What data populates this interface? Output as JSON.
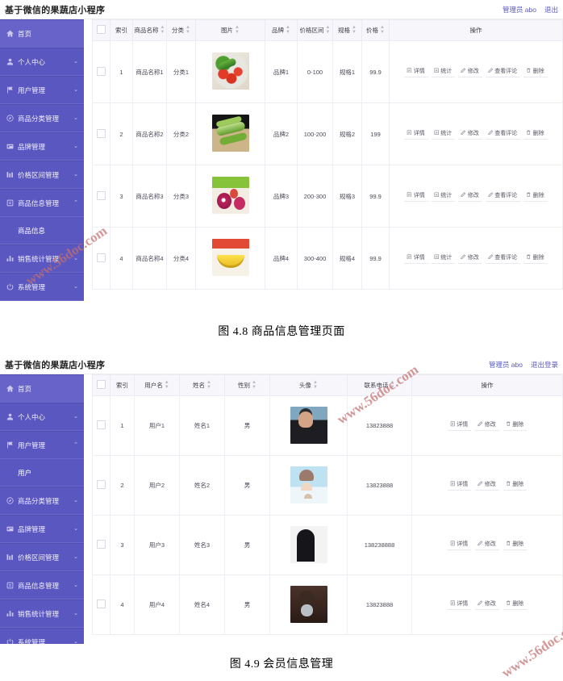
{
  "figures": [
    {
      "app_title": "基于微信的果蔬店小程序",
      "admin_label": "管理员 abo",
      "logout_label": "退出",
      "sidebar": [
        {
          "label": "首页",
          "icon": "home-icon",
          "caret": "",
          "active": true
        },
        {
          "label": "个人中心",
          "icon": "user-icon",
          "caret": "⌄",
          "active": false
        },
        {
          "label": "用户管理",
          "icon": "flag-icon",
          "caret": "⌄",
          "active": false
        },
        {
          "label": "商品分类管理",
          "icon": "compass-icon",
          "caret": "⌄",
          "active": false
        },
        {
          "label": "品牌管理",
          "icon": "tag-icon",
          "caret": "⌄",
          "active": false
        },
        {
          "label": "价格区间管理",
          "icon": "chart-icon",
          "caret": "⌄",
          "active": false
        },
        {
          "label": "商品信息管理",
          "icon": "box-icon",
          "caret": "⌃",
          "active": false,
          "sub": [
            "商品信息"
          ]
        },
        {
          "label": "销售统计管理",
          "icon": "bar-icon",
          "caret": "⌄",
          "active": false
        },
        {
          "label": "系统管理",
          "icon": "power-icon",
          "caret": "⌄",
          "active": false
        }
      ],
      "table": {
        "headers": [
          "",
          "索引",
          "商品名称",
          "分类",
          "图片",
          "品牌",
          "价格区间",
          "规格",
          "价格",
          "操作"
        ],
        "sortable": [
          false,
          false,
          true,
          true,
          true,
          true,
          true,
          true,
          true,
          false
        ],
        "rows": [
          {
            "index": "1",
            "name": "商品名称1",
            "category": "分类1",
            "image": "th-veg",
            "brand": "品牌1",
            "price_range": "0-100",
            "spec": "规格1",
            "price": "99.9"
          },
          {
            "index": "2",
            "name": "商品名称2",
            "category": "分类2",
            "image": "th-cuc",
            "brand": "品牌2",
            "price_range": "100-200",
            "spec": "规格2",
            "price": "199"
          },
          {
            "index": "3",
            "name": "商品名称3",
            "category": "分类3",
            "image": "th-drg",
            "brand": "品牌3",
            "price_range": "200-300",
            "spec": "规格3",
            "price": "99.9"
          },
          {
            "index": "4",
            "name": "商品名称4",
            "category": "分类4",
            "image": "th-ban",
            "brand": "品牌4",
            "price_range": "300-400",
            "spec": "规格4",
            "price": "99.9"
          }
        ],
        "actions": [
          "详情",
          "统计",
          "修改",
          "查看评论",
          "删除"
        ]
      },
      "caption": "图 4.8  商品信息管理页面"
    },
    {
      "app_title": "基于微信的果蔬店小程序",
      "admin_label": "管理员 abo",
      "logout_label": "退出登录",
      "sidebar": [
        {
          "label": "首页",
          "icon": "home-icon",
          "caret": "",
          "active": true
        },
        {
          "label": "个人中心",
          "icon": "user-icon",
          "caret": "⌄",
          "active": false
        },
        {
          "label": "用户管理",
          "icon": "flag-icon",
          "caret": "⌃",
          "active": false,
          "sub": [
            "用户"
          ]
        },
        {
          "label": "商品分类管理",
          "icon": "compass-icon",
          "caret": "⌄",
          "active": false
        },
        {
          "label": "品牌管理",
          "icon": "tag-icon",
          "caret": "⌄",
          "active": false
        },
        {
          "label": "价格区间管理",
          "icon": "chart-icon",
          "caret": "⌄",
          "active": false
        },
        {
          "label": "商品信息管理",
          "icon": "box-icon",
          "caret": "⌄",
          "active": false
        },
        {
          "label": "销售统计管理",
          "icon": "bar-icon",
          "caret": "⌄",
          "active": false
        },
        {
          "label": "系统管理",
          "icon": "power-icon",
          "caret": "⌄",
          "active": false
        }
      ],
      "table": {
        "headers": [
          "",
          "索引",
          "用户名",
          "姓名",
          "性别",
          "头像",
          "联系电话",
          "操作"
        ],
        "sortable": [
          false,
          false,
          true,
          true,
          true,
          true,
          true,
          false
        ],
        "rows": [
          {
            "index": "1",
            "username": "用户1",
            "name": "姓名1",
            "gender": "男",
            "avatar": "th-av1",
            "phone": "13823888"
          },
          {
            "index": "2",
            "username": "用户2",
            "name": "姓名2",
            "gender": "男",
            "avatar": "th-av2",
            "phone": "13823888"
          },
          {
            "index": "3",
            "username": "用户3",
            "name": "姓名3",
            "gender": "男",
            "avatar": "th-av3",
            "phone": "138238888"
          },
          {
            "index": "4",
            "username": "用户4",
            "name": "姓名4",
            "gender": "男",
            "avatar": "th-av4",
            "phone": "13823888"
          }
        ],
        "actions": [
          "详情",
          "修改",
          "删除"
        ]
      },
      "caption": "图 4.9 会员信息管理"
    }
  ],
  "watermarks": [
    "www.56doc.com",
    "www.56doc.com",
    "www.56doc.com"
  ],
  "colors": {
    "sidebar": "#5b57c0",
    "sidebar_active": "#6763c9",
    "link": "#5a5ac2",
    "watermark": "#c4706e"
  }
}
